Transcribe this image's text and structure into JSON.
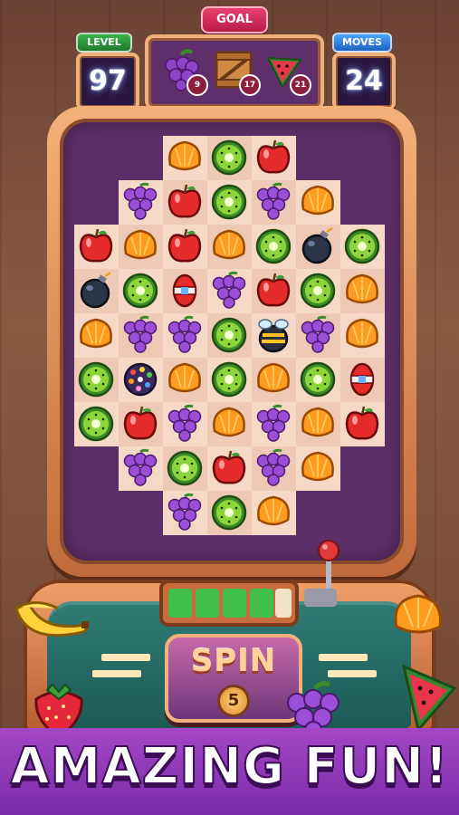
{
  "goal": {
    "label": "GOAL",
    "items": [
      {
        "icon": "grape-icon",
        "count": "9"
      },
      {
        "icon": "wooden-crate-icon",
        "count": "17"
      },
      {
        "icon": "watermelon-icon",
        "count": "21"
      }
    ]
  },
  "level": {
    "label": "LEVEL",
    "value": "97"
  },
  "moves": {
    "label": "MOVES",
    "value": "24"
  },
  "board": {
    "rows": [
      [
        "",
        "",
        "orange",
        "kiwi",
        "apple",
        "",
        ""
      ],
      [
        "",
        "grape",
        "apple",
        "kiwi",
        "grape",
        "orange",
        ""
      ],
      [
        "apple",
        "orange",
        "apple",
        "orange",
        "kiwi",
        "bomb",
        "kiwi"
      ],
      [
        "bomb",
        "kiwi",
        "rocket",
        "grape",
        "apple",
        "kiwi",
        "orange"
      ],
      [
        "orange",
        "grape",
        "grape",
        "kiwi",
        "bee-bomb",
        "grape",
        "orange"
      ],
      [
        "kiwi",
        "color-bomb",
        "orange",
        "kiwi",
        "orange",
        "kiwi",
        "rocket"
      ],
      [
        "kiwi",
        "apple",
        "grape",
        "orange",
        "grape",
        "orange",
        "apple"
      ],
      [
        "",
        "grape",
        "kiwi",
        "apple",
        "grape",
        "orange",
        ""
      ],
      [
        "",
        "",
        "grape",
        "kiwi",
        "orange",
        "",
        ""
      ]
    ]
  },
  "spin": {
    "label": "SPIN",
    "count": "5"
  },
  "banner": {
    "text": "AMAZING FUN!"
  },
  "colors": {
    "accent": "#a347c6",
    "board": "#5d2f68",
    "frame": "#f0b07a"
  }
}
